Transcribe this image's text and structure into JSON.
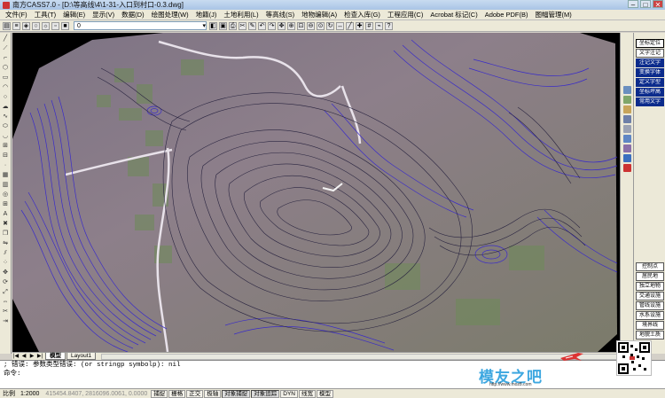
{
  "window": {
    "title": "南方CASS7.0 - [D:\\等高线\\4\\1-31-入口到村口-0.3.dwg]"
  },
  "menu": [
    "文件(F)",
    "工具(T)",
    "编辑(E)",
    "显示(V)",
    "数据(D)",
    "绘图处理(W)",
    "地籍(J)",
    "土地利用(L)",
    "等高线(S)",
    "地物编辑(A)",
    "检查入库(G)",
    "工程应用(C)",
    "Acrobat 标记(C)",
    "Adobe PDF(B)",
    "图幅管理(M)"
  ],
  "toolbar": {
    "layer_value": "0"
  },
  "right_menu": {
    "top": [
      "坐标定位",
      "文字注记",
      "注记文字",
      "变换字体",
      "定义字型",
      "坐标坪高",
      "常用文字"
    ],
    "bottom": [
      "控制点",
      "居民地",
      "独立地物",
      "交通设施",
      "管线设施",
      "水系设施",
      "境界线",
      "地貌土质"
    ]
  },
  "tabs": {
    "model": "模型",
    "layout": "Layout1"
  },
  "command": {
    "line1": "; 错误: 参数类型错误: (or stringp symbolp): nil",
    "line2": "命令:"
  },
  "status": {
    "scale_label": "比例",
    "scale_value": "1:2000",
    "coordinates": "415454.8407, 2816096.0061, 0.0000",
    "buttons": [
      "捕捉",
      "栅格",
      "正交",
      "极轴",
      "对象捕捉",
      "对象追踪",
      "DYN",
      "线宽",
      "模型"
    ]
  },
  "watermark": {
    "logo": "模友之吧",
    "url": "http://www.moz8.com"
  },
  "colors": {
    "contour_blue": "#3a2cc8",
    "contour_dark": "#2a2540",
    "map_base": "#8a7a86",
    "field_green": "#6f8a5a",
    "selected_panel": "#0b2b8c"
  }
}
